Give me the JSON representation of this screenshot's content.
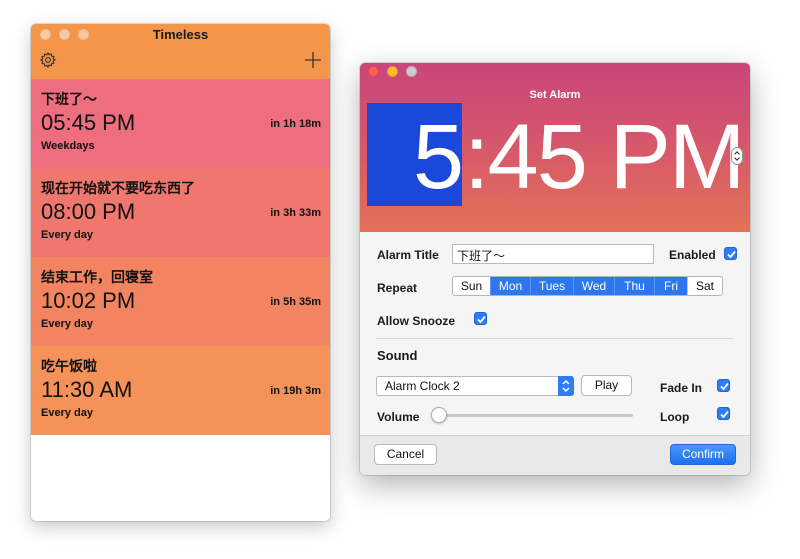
{
  "left_window": {
    "title": "Timeless",
    "alarms": [
      {
        "title": "下班了～",
        "time": "05:45 PM",
        "repeat": "Weekdays",
        "countdown": "in 1h 18m",
        "color": "#ee6d7e"
      },
      {
        "title": "现在开始就不要吃东西了",
        "time": "08:00 PM",
        "repeat": "Every day",
        "countdown": "in 3h 33m",
        "color": "#f0776e"
      },
      {
        "title": "结束工作，回寝室",
        "time": "10:02 PM",
        "repeat": "Every day",
        "countdown": "in 5h 35m",
        "color": "#f28462"
      },
      {
        "title": "吃午饭啦",
        "time": "11:30 AM",
        "repeat": "Every day",
        "countdown": "in 19h 3m",
        "color": "#f4925a"
      }
    ],
    "icons": {
      "settings": "gear-icon",
      "add": "plus-icon"
    },
    "accent": "#f3964a"
  },
  "set_alarm": {
    "title": "Set Alarm",
    "time_hour": "5",
    "time_rest": ":45 PM",
    "labels": {
      "alarm_title": "Alarm Title",
      "enabled": "Enabled",
      "repeat": "Repeat",
      "allow_snooze": "Allow Snooze",
      "sound": "Sound",
      "volume": "Volume",
      "fade_in": "Fade In",
      "loop": "Loop"
    },
    "alarm_title_value": "下班了～",
    "days": [
      {
        "label": "Sun",
        "on": false
      },
      {
        "label": "Mon",
        "on": true
      },
      {
        "label": "Tues",
        "on": true
      },
      {
        "label": "Wed",
        "on": true
      },
      {
        "label": "Thu",
        "on": true
      },
      {
        "label": "Fri",
        "on": true
      },
      {
        "label": "Sat",
        "on": false
      }
    ],
    "enabled": true,
    "allow_snooze": true,
    "fade_in": true,
    "loop": true,
    "sound_value": "Alarm Clock 2",
    "play_label": "Play",
    "volume_level": 0,
    "cancel_label": "Cancel",
    "confirm_label": "Confirm",
    "accent": "#2e7cf6"
  }
}
